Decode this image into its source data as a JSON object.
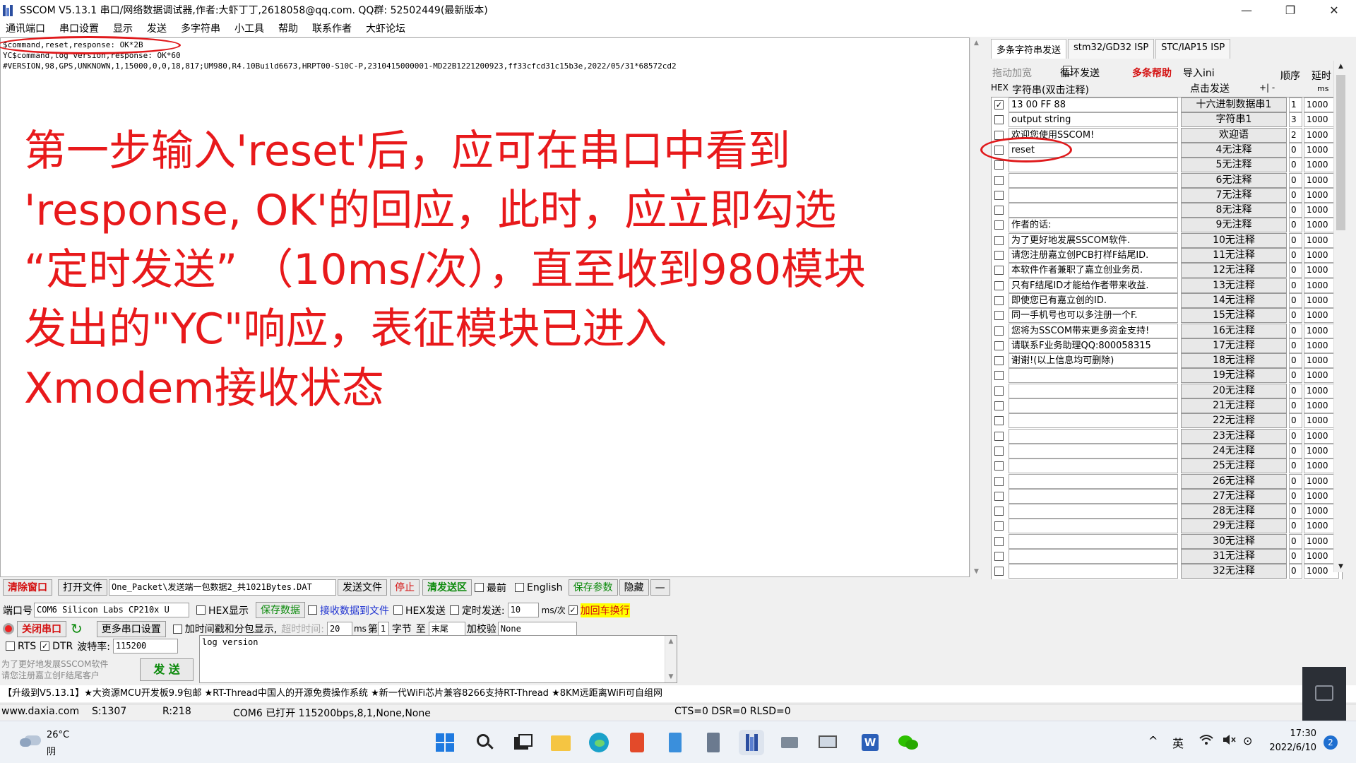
{
  "window": {
    "title": "SSCOM V5.13.1 串口/网络数据调试器,作者:大虾丁丁,2618058@qq.com. QQ群: 52502449(最新版本)",
    "controls": [
      "—",
      "❐",
      "✕"
    ]
  },
  "menu": [
    "通讯端口",
    "串口设置",
    "显示",
    "发送",
    "多字符串",
    "小工具",
    "帮助",
    "联系作者",
    "大虾论坛"
  ],
  "receive": {
    "lines": [
      "$command,reset,response: OK*2B",
      "YC$command,log version,response: OK*60",
      "#VERSION,98,GPS,UNKNOWN,1,15000,0,0,18,817;UM980,R4.10Build6673,HRPT00-S10C-P,2310415000001-MD22B1221200923,ff33cfcd31c15b3e,2022/05/31*68572cd2"
    ]
  },
  "annotation": {
    "lines": [
      "第一步输入'reset'后，应可在串口中看到",
      "'response, OK'的回应，此时，应立即勾选",
      "“定时发送” （10ms/次），直至收到980模块",
      "发出的\"YC\"响应，表征模块已进入",
      "Xmodem接收状态"
    ],
    "color": "#e8191b"
  },
  "right_panel": {
    "tabs": [
      "多条字符串发送",
      "stm32/GD32 ISP",
      "STC/IAP15 ISP"
    ],
    "header": {
      "drag_label": "拖动加宽",
      "loop_send": "循环发送",
      "multi_help": "多条帮助",
      "import_ini": "导入ini",
      "order_label": "顺序",
      "delay_label": "延时",
      "hex_label": "HEX",
      "string_label": "字符串(双击注释)",
      "click_send": "点击发送",
      "plus_minus": "+| -",
      "ms_label": "ms"
    },
    "rows": [
      {
        "checked": true,
        "text": "13 00 FF 88",
        "button": "十六进制数据串1",
        "order": "1",
        "ms": "1000"
      },
      {
        "checked": false,
        "text": "output string",
        "button": "字符串1",
        "order": "3",
        "ms": "1000"
      },
      {
        "checked": false,
        "text": "欢迎您使用SSCOM!",
        "button": "欢迎语",
        "order": "2",
        "ms": "1000"
      },
      {
        "checked": false,
        "text": "reset",
        "button": "4无注释",
        "order": "0",
        "ms": "1000"
      },
      {
        "checked": false,
        "text": "",
        "button": "5无注释",
        "order": "0",
        "ms": "1000"
      },
      {
        "checked": false,
        "text": "",
        "button": "6无注释",
        "order": "0",
        "ms": "1000"
      },
      {
        "checked": false,
        "text": "",
        "button": "7无注释",
        "order": "0",
        "ms": "1000"
      },
      {
        "checked": false,
        "text": "",
        "button": "8无注释",
        "order": "0",
        "ms": "1000"
      },
      {
        "checked": false,
        "text": "作者的话:",
        "button": "9无注释",
        "order": "0",
        "ms": "1000"
      },
      {
        "checked": false,
        "text": "为了更好地发展SSCOM软件.",
        "button": "10无注释",
        "order": "0",
        "ms": "1000"
      },
      {
        "checked": false,
        "text": "请您注册嘉立创PCB打样F结尾ID.",
        "button": "11无注释",
        "order": "0",
        "ms": "1000"
      },
      {
        "checked": false,
        "text": "本软件作者兼职了嘉立创业务员.",
        "button": "12无注释",
        "order": "0",
        "ms": "1000"
      },
      {
        "checked": false,
        "text": "只有F结尾ID才能给作者带来收益.",
        "button": "13无注释",
        "order": "0",
        "ms": "1000"
      },
      {
        "checked": false,
        "text": "即使您已有嘉立创的ID.",
        "button": "14无注释",
        "order": "0",
        "ms": "1000"
      },
      {
        "checked": false,
        "text": "同一手机号也可以多注册一个F.",
        "button": "15无注释",
        "order": "0",
        "ms": "1000"
      },
      {
        "checked": false,
        "text": "您将为SSCOM带来更多资金支持!",
        "button": "16无注释",
        "order": "0",
        "ms": "1000"
      },
      {
        "checked": false,
        "text": "请联系F业务助理QQ:800058315",
        "button": "17无注释",
        "order": "0",
        "ms": "1000"
      },
      {
        "checked": false,
        "text": "谢谢!(以上信息均可删除)",
        "button": "18无注释",
        "order": "0",
        "ms": "1000"
      },
      {
        "checked": false,
        "text": "",
        "button": "19无注释",
        "order": "0",
        "ms": "1000"
      },
      {
        "checked": false,
        "text": "",
        "button": "20无注释",
        "order": "0",
        "ms": "1000"
      },
      {
        "checked": false,
        "text": "",
        "button": "21无注释",
        "order": "0",
        "ms": "1000"
      },
      {
        "checked": false,
        "text": "",
        "button": "22无注释",
        "order": "0",
        "ms": "1000"
      },
      {
        "checked": false,
        "text": "",
        "button": "23无注释",
        "order": "0",
        "ms": "1000"
      },
      {
        "checked": false,
        "text": "",
        "button": "24无注释",
        "order": "0",
        "ms": "1000"
      },
      {
        "checked": false,
        "text": "",
        "button": "25无注释",
        "order": "0",
        "ms": "1000"
      },
      {
        "checked": false,
        "text": "",
        "button": "26无注释",
        "order": "0",
        "ms": "1000"
      },
      {
        "checked": false,
        "text": "",
        "button": "27无注释",
        "order": "0",
        "ms": "1000"
      },
      {
        "checked": false,
        "text": "",
        "button": "28无注释",
        "order": "0",
        "ms": "1000"
      },
      {
        "checked": false,
        "text": "",
        "button": "29无注释",
        "order": "0",
        "ms": "1000"
      },
      {
        "checked": false,
        "text": "",
        "button": "30无注释",
        "order": "0",
        "ms": "1000"
      },
      {
        "checked": false,
        "text": "",
        "button": "31无注释",
        "order": "0",
        "ms": "1000"
      },
      {
        "checked": false,
        "text": "",
        "button": "32无注释",
        "order": "0",
        "ms": "1000"
      }
    ]
  },
  "toolbar": {
    "clear": "清除窗口",
    "open_file": "打开文件",
    "file_path": "One_Packet\\发送端一包数据2_共1021Bytes.DAT",
    "send_file": "发送文件",
    "stop": "停止",
    "clear_send": "清发送区",
    "topmost": "最前",
    "english": "English",
    "save_params": "保存参数",
    "hide": "隐藏",
    "dash": "—"
  },
  "port": {
    "port_label": "端口号",
    "port_value": "COM6 Silicon Labs CP210x U",
    "hex_display": "HEX显示",
    "save_data": "保存数据",
    "recv_to_file": "接收数据到文件",
    "hex_send": "HEX发送",
    "timed_send": "定时发送:",
    "interval": "10",
    "ms_per": "ms/次",
    "add_crlf": "加回车换行",
    "close_port": "关闭串口",
    "more_settings": "更多串口设置",
    "timestamp": "加时间戳和分包显示,",
    "timeout": "超时时间:",
    "timeout_val": "20",
    "ms": "ms",
    "nth": "第",
    "nth_val": "1",
    "byte": "字节",
    "to": "至",
    "end": "末尾",
    "checksum": "加校验",
    "checksum_val": "None",
    "rts": "RTS",
    "dtr": "DTR",
    "baud_label": "波特率:",
    "baud_value": "115200",
    "send_text": "log version",
    "promo": "为了更好地发展SSCOM软件\n请您注册嘉立创F结尾客户",
    "send_button": "发  送"
  },
  "ticker": "【升级到V5.13.1】★大资源MCU开发板9.9包邮 ★RT-Thread中国人的开源免费操作系统 ★新一代WiFi芯片兼容8266支持RT-Thread ★8KM远距离WiFi可自组网",
  "status": {
    "site": "www.daxia.com",
    "sent": "S:1307",
    "received": "R:218",
    "port_info": "COM6 已打开  115200bps,8,1,None,None",
    "lines": "CTS=0 DSR=0 RLSD=0"
  },
  "taskbar": {
    "weather_temp": "26°C",
    "weather_desc": "阴",
    "lang": "英",
    "time": "17:30",
    "date": "2022/6/10",
    "notif": "2",
    "chevron": "^",
    "ime_mode": "⊙",
    "battery": "▭"
  }
}
